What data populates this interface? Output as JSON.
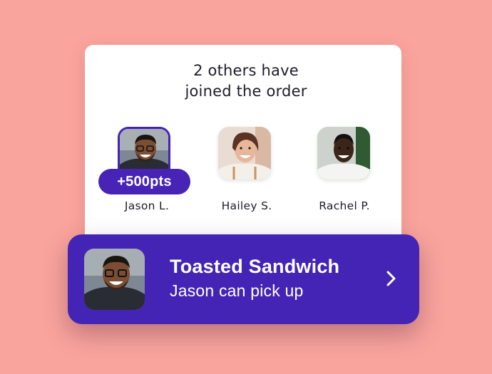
{
  "background_color": "#F9A49D",
  "accent_color": "#4424B4",
  "card": {
    "title_line1": "2 others have",
    "title_line2": "joined the order"
  },
  "members": [
    {
      "name": "Jason L.",
      "badge": "+500pts",
      "selected": true,
      "avatar_icon": "person-photo-avatar"
    },
    {
      "name": "Hailey S.",
      "selected": false,
      "avatar_icon": "person-photo-avatar"
    },
    {
      "name": "Rachel P.",
      "selected": false,
      "avatar_icon": "person-photo-avatar"
    }
  ],
  "order": {
    "item_name": "Toasted Sandwich",
    "pickup_text": "Jason can pick up",
    "action_icon": "chevron-right-icon"
  }
}
